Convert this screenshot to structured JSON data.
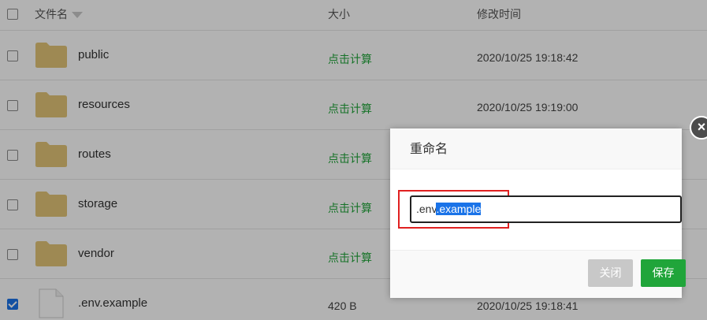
{
  "header": {
    "name_label": "文件名",
    "size_label": "大小",
    "time_label": "修改时间"
  },
  "rows": [
    {
      "name": "public",
      "size": "点击计算",
      "time": "2020/10/25 19:18:42",
      "type": "folder",
      "checked": false
    },
    {
      "name": "resources",
      "size": "点击计算",
      "time": "2020/10/25 19:19:00",
      "type": "folder",
      "checked": false
    },
    {
      "name": "routes",
      "size": "点击计算",
      "time": "",
      "type": "folder",
      "checked": false
    },
    {
      "name": "storage",
      "size": "点击计算",
      "time": "",
      "type": "folder",
      "checked": false
    },
    {
      "name": "vendor",
      "size": "点击计算",
      "time": "",
      "type": "folder",
      "checked": false
    },
    {
      "name": ".env.example",
      "size": "420 B",
      "time": "2020/10/25 19:18:41",
      "type": "file",
      "checked": true
    }
  ],
  "dialog": {
    "title": "重命名",
    "input_prefix": ".env",
    "input_selected": ".example",
    "close_label": "关闭",
    "save_label": "保存",
    "close_icon": "×"
  },
  "colors": {
    "accent_green": "#20a53a",
    "folder": "#e2c578",
    "selection": "#1a73e8"
  }
}
